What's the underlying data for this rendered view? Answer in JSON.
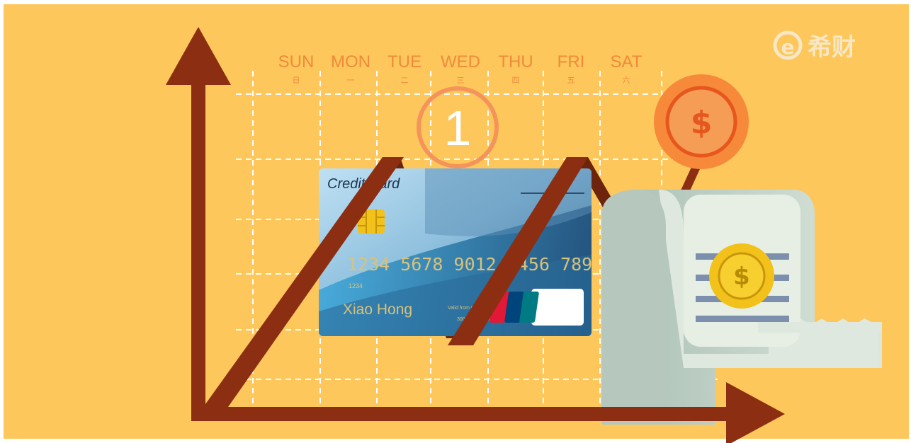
{
  "calendar": {
    "days": [
      {
        "en": "SUN",
        "cn": "日"
      },
      {
        "en": "MON",
        "cn": "一"
      },
      {
        "en": "TUE",
        "cn": "二"
      },
      {
        "en": "WED",
        "cn": "三"
      },
      {
        "en": "THU",
        "cn": "四"
      },
      {
        "en": "FRI",
        "cn": "五"
      },
      {
        "en": "SAT",
        "cn": "六"
      }
    ],
    "highlight_number": "1"
  },
  "card": {
    "title": "Credit Card",
    "number": "1234 5678 9012 3456 789",
    "small_code": "1234",
    "holder": "Xiao Hong",
    "valid_text": "Valid from 00/00 thru 00/00 end",
    "valid_sub": "3000 00/00 00/00/12",
    "brand_top": "UnionPay",
    "brand_bottom": "银联"
  },
  "coins": {
    "large_symbol": "$",
    "small_symbol": "$"
  },
  "watermark": {
    "text": "希财",
    "logo_glyph": "e"
  },
  "colors": {
    "background": "#fdc75c",
    "arrow": "#8b2e12",
    "calendar_text": "#f08a3a",
    "coin_outer": "#f7893a",
    "coin_small": "#f2c21b"
  }
}
